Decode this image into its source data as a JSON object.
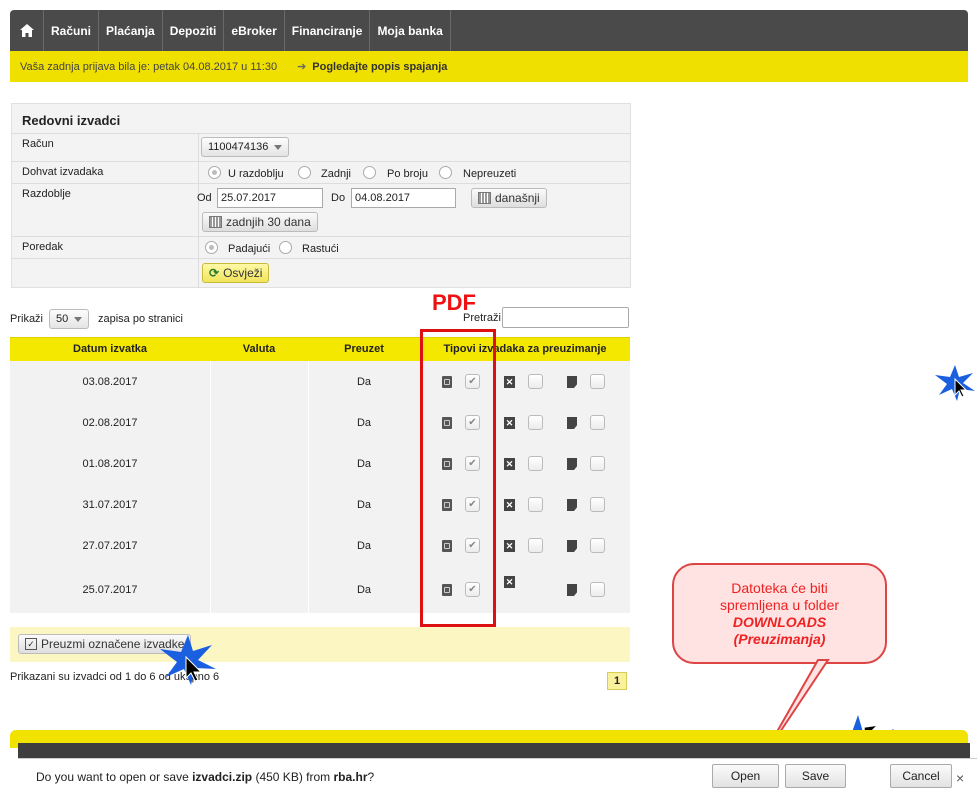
{
  "nav": {
    "home_icon": "home-icon",
    "items": [
      "Računi",
      "Plaćanja",
      "Depoziti",
      "eBroker",
      "Financiranje",
      "Moja banka"
    ]
  },
  "notice": {
    "text": "Vaša zadnja prijava bila je: petak 04.08.2017 u 11:30",
    "link": "Pogledajte popis spajanja"
  },
  "form": {
    "title": "Redovni izvadci",
    "account_label": "Račun",
    "account_value": "1100474136",
    "fetch_label": "Dohvat izvadaka",
    "fetch_options": [
      "U razdoblju",
      "Zadnji",
      "Po broju",
      "Nepreuzeti"
    ],
    "period_label": "Razdoblje",
    "from_label": "Od",
    "from_value": "25.07.2017",
    "to_label": "Do",
    "to_value": "04.08.2017",
    "today_button": "današnji",
    "last30_button": "zadnjih 30 dana",
    "order_label": "Poredak",
    "order_options": [
      "Padajući",
      "Rastući"
    ],
    "refresh_button": "Osvježi"
  },
  "list": {
    "show_label": "Prikaži",
    "page_size": "50",
    "per_page_label": "zapisa po stranici",
    "search_label": "Pretraži",
    "search_value": ""
  },
  "table": {
    "columns": [
      "Datum izvatka",
      "Valuta",
      "Preuzet",
      "Tipovi izvadaka za preuzimanje"
    ],
    "rows": [
      {
        "date": "03.08.2017",
        "currency": "",
        "downloaded": "Da"
      },
      {
        "date": "02.08.2017",
        "currency": "",
        "downloaded": "Da"
      },
      {
        "date": "01.08.2017",
        "currency": "",
        "downloaded": "Da"
      },
      {
        "date": "31.07.2017",
        "currency": "",
        "downloaded": "Da"
      },
      {
        "date": "27.07.2017",
        "currency": "",
        "downloaded": "Da"
      },
      {
        "date": "25.07.2017",
        "currency": "",
        "downloaded": "Da"
      }
    ]
  },
  "footer": {
    "download_button": "Preuzmi označene izvadke",
    "summary": "Prikazani su izvadci od 1 do 6 od ukupno 6",
    "page": "1"
  },
  "annotation": {
    "pdf_label": "PDF",
    "callout_line1": "Datoteka će biti",
    "callout_line2": "spremljena u folder",
    "callout_line3": "DOWNLOADS",
    "callout_line4": "(Preuzimanja)"
  },
  "download_bar": {
    "prefix": "Do you want to open or save ",
    "filename": "izvadci.zip",
    "size": " (450 KB) from ",
    "site": "rba.hr",
    "suffix": "?",
    "open": "Open",
    "save": "Save",
    "cancel": "Cancel",
    "close": "×"
  },
  "colors": {
    "accent_yellow": "#f5e800",
    "nav_dark": "#4a4a4a",
    "annotation_red": "#dd1111"
  }
}
